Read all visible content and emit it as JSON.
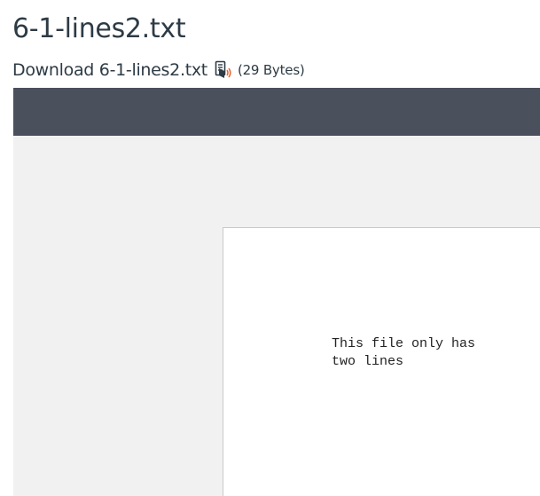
{
  "header": {
    "title": "6-1-lines2.txt"
  },
  "download": {
    "link_text": "Download 6-1-lines2.txt",
    "reader_icon": "immersive-reader-icon",
    "size_text": "(29 Bytes)"
  },
  "viewer": {
    "file_content": "This file only has\ntwo lines"
  },
  "colors": {
    "text": "#2d3b45",
    "toolbar": "#4a505c",
    "viewer_background": "#f1f1f1",
    "icon_accent": "#e8622c"
  }
}
